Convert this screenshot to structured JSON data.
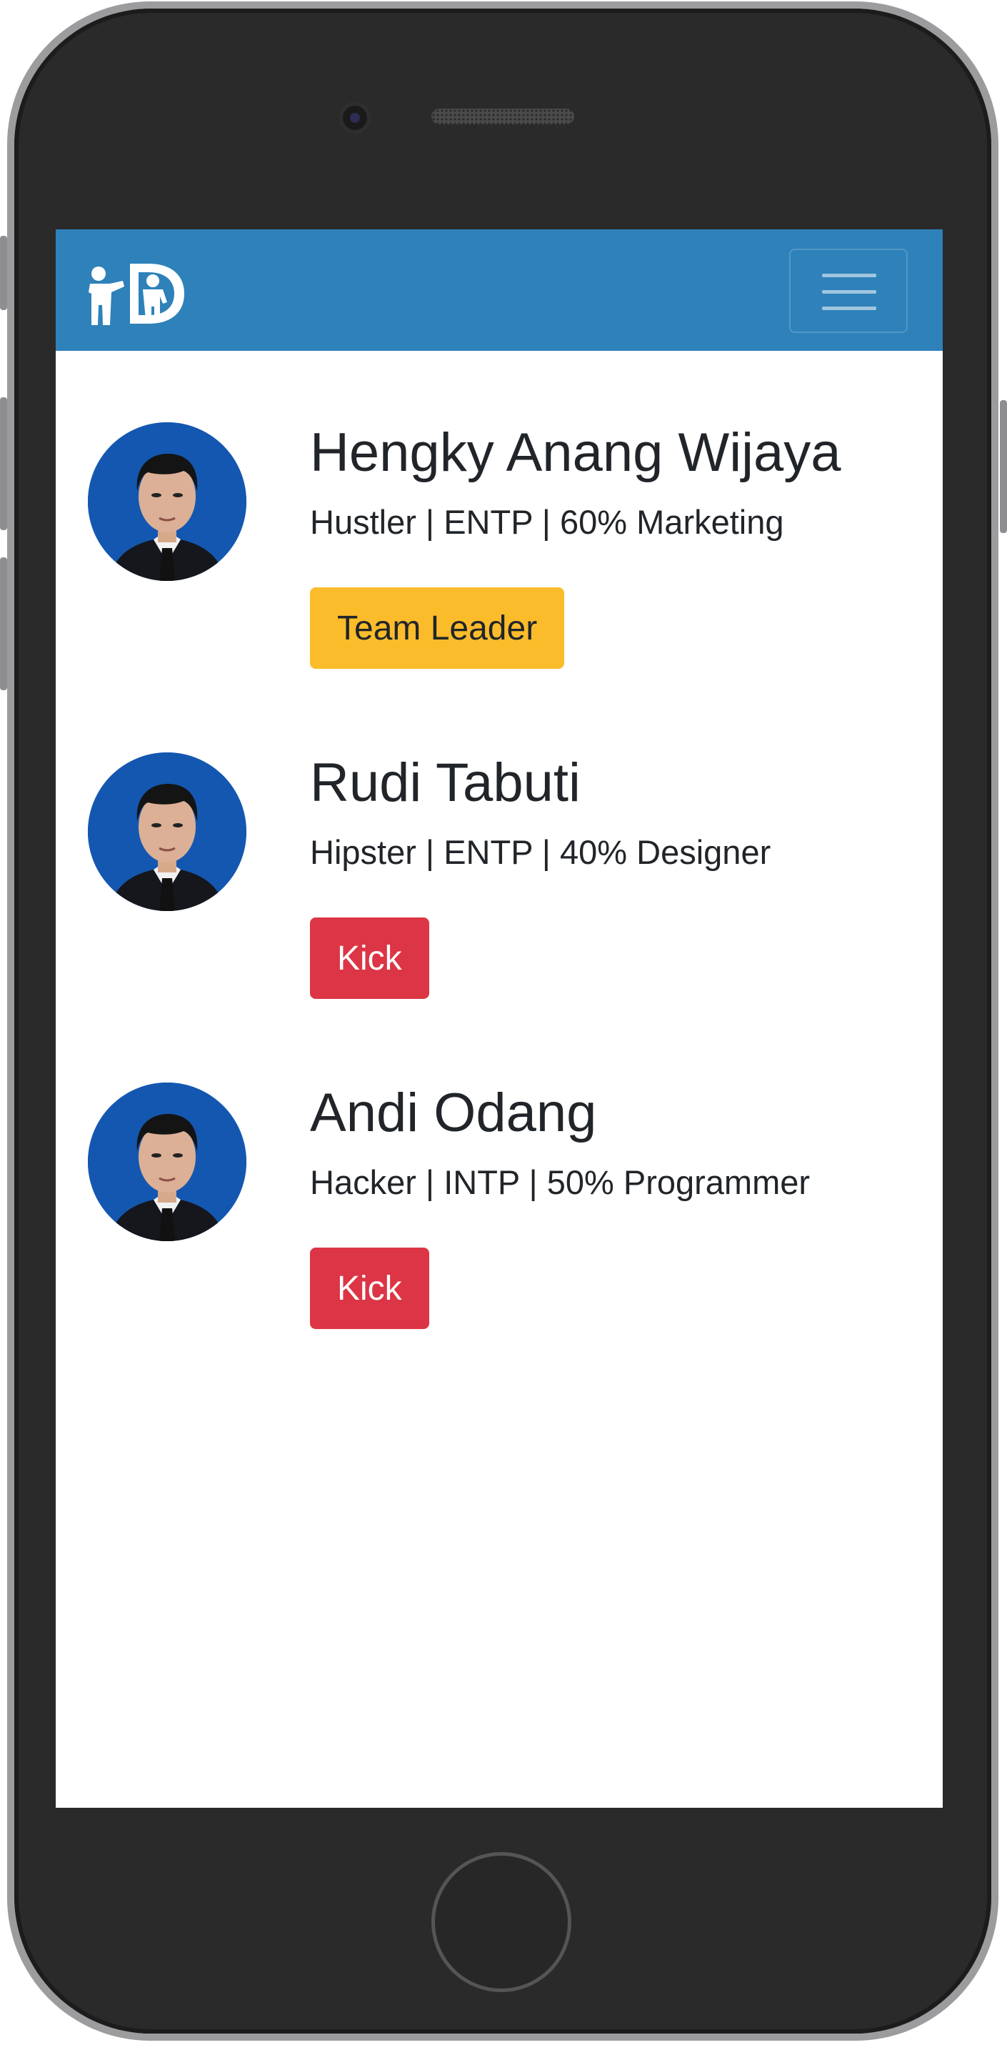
{
  "navbar": {
    "brand_icon": "family-logo-icon",
    "toggle_icon": "hamburger-menu-icon",
    "color": "#2e81b9"
  },
  "members": [
    {
      "name": "Hengky Anang Wijaya",
      "meta": "Hustler | ENTP | 60% Marketing",
      "action_label": "Team Leader",
      "action_style": "warning"
    },
    {
      "name": "Rudi Tabuti",
      "meta": "Hipster | ENTP | 40% Designer",
      "action_label": "Kick",
      "action_style": "danger"
    },
    {
      "name": "Andi Odang",
      "meta": "Hacker | INTP | 50% Programmer",
      "action_label": "Kick",
      "action_style": "danger"
    }
  ],
  "colors": {
    "warning": "#fbbc2b",
    "danger": "#dc3545",
    "avatar_bg": "#1457b0"
  }
}
